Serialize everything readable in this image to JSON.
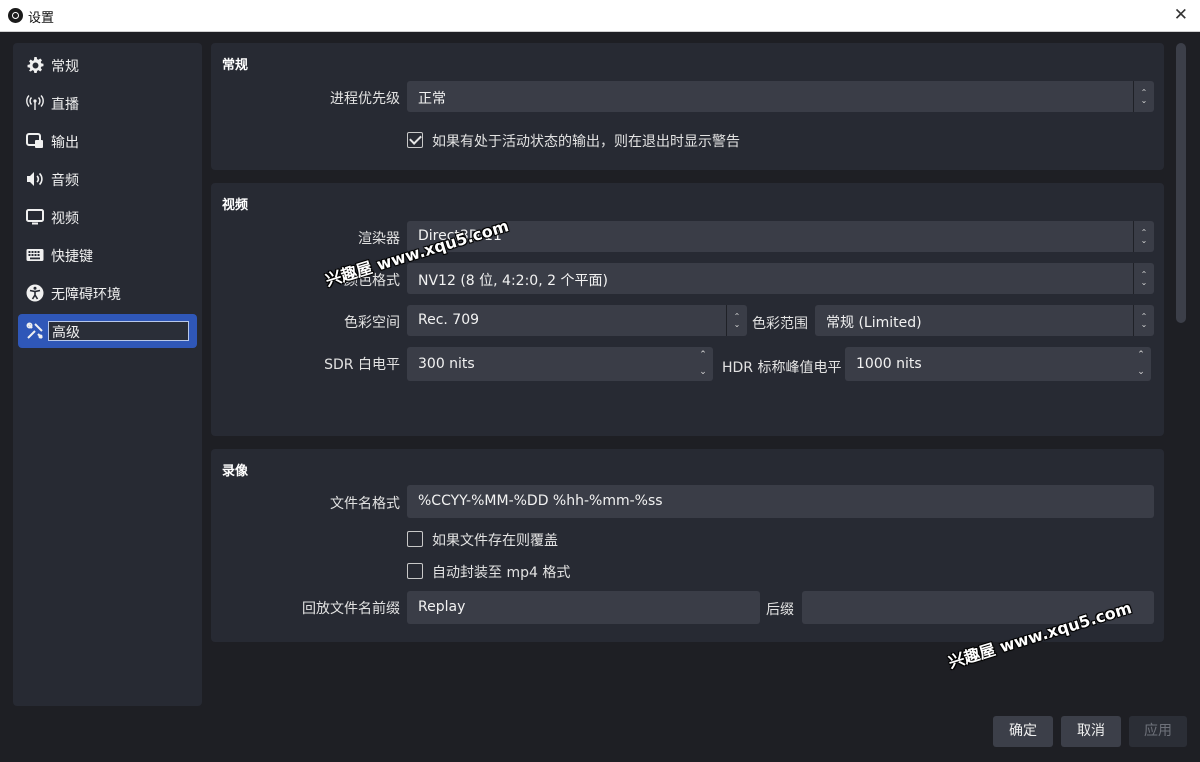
{
  "window": {
    "title": "设置"
  },
  "sidebar": {
    "items": [
      {
        "label": "常规",
        "icon": "gear-icon"
      },
      {
        "label": "直播",
        "icon": "broadcast-icon"
      },
      {
        "label": "输出",
        "icon": "output-icon"
      },
      {
        "label": "音频",
        "icon": "speaker-icon"
      },
      {
        "label": "视频",
        "icon": "monitor-icon"
      },
      {
        "label": "快捷键",
        "icon": "keyboard-icon"
      },
      {
        "label": "无障碍环境",
        "icon": "accessibility-icon"
      },
      {
        "label": "高级",
        "icon": "tools-icon",
        "active": true
      }
    ]
  },
  "general": {
    "title": "常规",
    "priority_label": "进程优先级",
    "priority_value": "正常",
    "warn_checkbox_label": "如果有处于活动状态的输出，则在退出时显示警告",
    "warn_checked": true
  },
  "video": {
    "title": "视频",
    "renderer_label": "渲染器",
    "renderer_value": "Direct3D 11",
    "color_format_label": "颜色格式",
    "color_format_value": "NV12 (8 位, 4:2:0, 2 个平面)",
    "color_space_label": "色彩空间",
    "color_space_value": "Rec. 709",
    "color_range_label": "色彩范围",
    "color_range_value": "常规 (Limited)",
    "sdr_label": "SDR 白电平",
    "sdr_value": "300 nits",
    "hdr_label": "HDR 标称峰值电平",
    "hdr_value": "1000 nits"
  },
  "recording": {
    "title": "录像",
    "filename_label": "文件名格式",
    "filename_value": "%CCYY-%MM-%DD %hh-%mm-%ss",
    "overwrite_label": "如果文件存在则覆盖",
    "overwrite_checked": false,
    "remux_label": "自动封装至 mp4 格式",
    "remux_checked": false,
    "replay_prefix_label": "回放文件名前缀",
    "replay_prefix_value": "Replay",
    "suffix_label": "后缀",
    "suffix_value": ""
  },
  "buttons": {
    "ok": "确定",
    "cancel": "取消",
    "apply": "应用"
  },
  "watermark": {
    "text": "兴趣屋 www.xqu5.com"
  },
  "colors": {
    "accent": "#2f57b8",
    "panel": "#272a33",
    "background": "#1e1f24",
    "field": "#3a3d47"
  }
}
